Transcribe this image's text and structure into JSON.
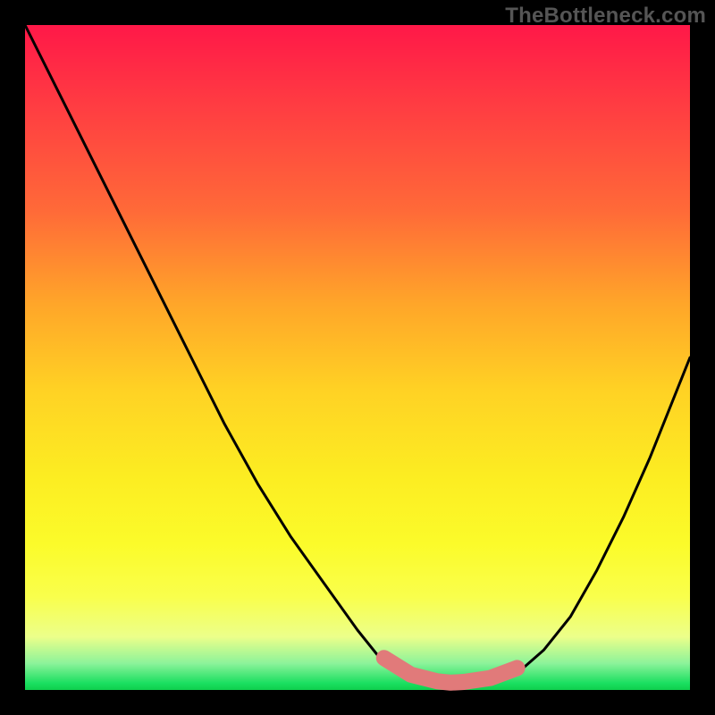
{
  "attribution": "TheBottleneck.com",
  "colors": {
    "frame": "#000000",
    "curve": "#000000",
    "highlight": "#e17a7a",
    "gradient_top": "#ff1848",
    "gradient_bottom": "#0fcf4c"
  },
  "chart_data": {
    "type": "line",
    "title": "",
    "xlabel": "",
    "ylabel": "",
    "xlim": [
      0,
      100
    ],
    "ylim": [
      0,
      100
    ],
    "x": [
      0,
      5,
      10,
      15,
      20,
      25,
      30,
      35,
      40,
      45,
      50,
      54,
      58,
      62,
      64,
      66,
      70,
      74,
      78,
      82,
      86,
      90,
      94,
      100
    ],
    "values": [
      100,
      90,
      80,
      70,
      60,
      50,
      40,
      31,
      23,
      16,
      9,
      4,
      1.5,
      0.5,
      0.3,
      0.4,
      1,
      2.5,
      6,
      11,
      18,
      26,
      35,
      50
    ],
    "annotations": [
      {
        "kind": "highlight_segment",
        "x_range": [
          54,
          74
        ],
        "note": "thick coral band near curve minimum"
      }
    ]
  }
}
